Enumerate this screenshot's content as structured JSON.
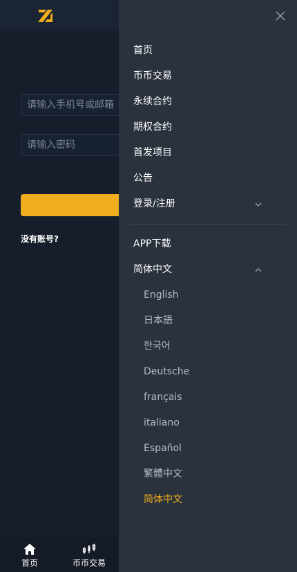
{
  "login": {
    "phone_placeholder": "请输入手机号或邮箱",
    "password_placeholder": "请输入密码",
    "no_account": "没有账号?"
  },
  "tabbar": {
    "home": "首页",
    "spot": "币币交易"
  },
  "drawer": {
    "menu": [
      "首页",
      "币币交易",
      "永续合约",
      "期权合约",
      "首发项目",
      "公告"
    ],
    "login_register": "登录/注册",
    "app_download": "APP下载",
    "language_label": "简体中文",
    "languages": [
      "English",
      "日本語",
      "한국어",
      "Deutsche",
      "français",
      "italiano",
      "Español",
      "繁體中文",
      "简体中文"
    ]
  },
  "colors": {
    "accent": "#f0ad1d",
    "drawer_bg": "#2a323d",
    "page_bg": "#161e2b"
  },
  "icons": {
    "logo": "brand-logo-icon",
    "close": "close-icon",
    "chevron_down": "chevron-down-icon",
    "chevron_up": "chevron-up-icon",
    "home": "home-icon",
    "spot": "candlestick-icon"
  }
}
